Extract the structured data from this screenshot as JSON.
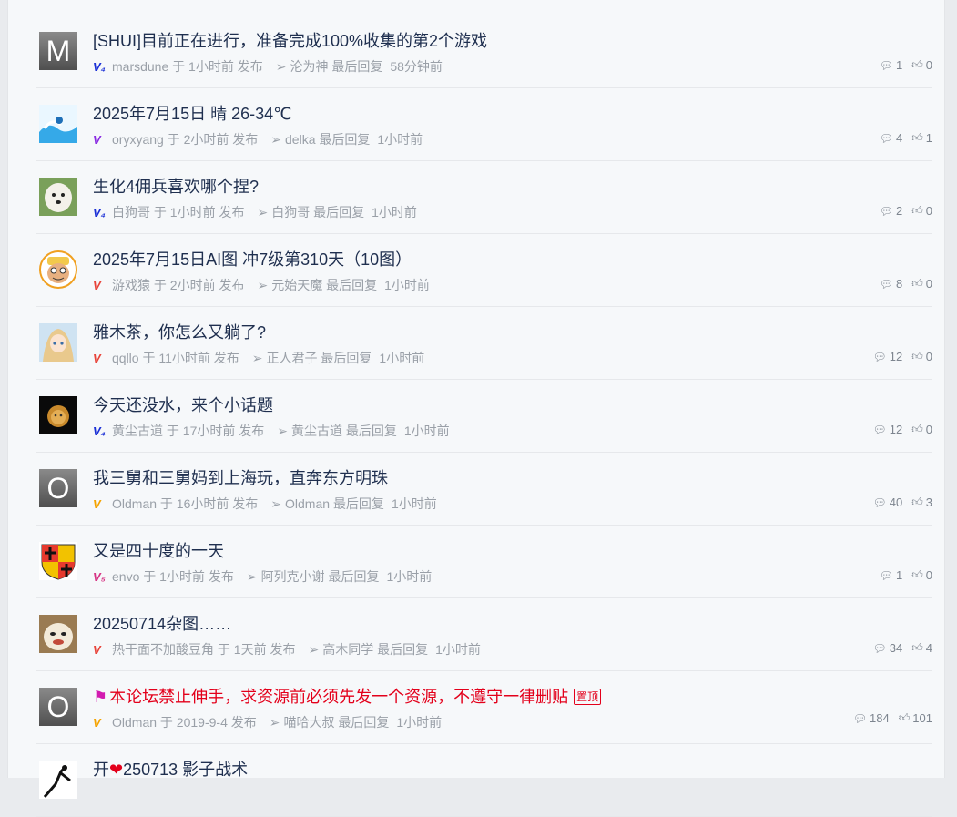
{
  "threads": [
    {
      "title": "[SHUI]目前正在进行，准备完成100%收集的第2个游戏",
      "badge": "V₄",
      "badge_color": "#1a2fd6",
      "author": "marsdune",
      "posted": "于 1小时前 发布",
      "last_replier": "沦为神",
      "last_label": "最后回复",
      "last_time": "58分钟前",
      "replies": "1",
      "likes": "0",
      "avatar_letter": "M",
      "avatar_type": "letter"
    },
    {
      "title": "2025年7月15日 晴 26-34℃",
      "badge": "V",
      "badge_color": "#8a2be2",
      "author": "oryxyang",
      "posted": "于 2小时前 发布",
      "last_replier": "delka",
      "last_label": "最后回复",
      "last_time": "1小时前",
      "replies": "4",
      "likes": "1",
      "avatar_type": "wave"
    },
    {
      "title": "生化4佣兵喜欢哪个捏?",
      "badge": "V₄",
      "badge_color": "#1a2fd6",
      "author": "白狗哥",
      "posted": "于 1小时前 发布",
      "last_replier": "白狗哥",
      "last_label": "最后回复",
      "last_time": "1小时前",
      "replies": "2",
      "likes": "0",
      "avatar_type": "dog"
    },
    {
      "title": "2025年7月15日AI图 冲7级第310天（10图）",
      "badge": "V",
      "badge_color": "#e8443a",
      "author": "游戏猿",
      "posted": "于 2小时前 发布",
      "last_replier": "元始天魔",
      "last_label": "最后回复",
      "last_time": "1小时前",
      "replies": "8",
      "likes": "0",
      "avatar_type": "monkey"
    },
    {
      "title": "雅木茶，你怎么又躺了?",
      "badge": "V",
      "badge_color": "#e8443a",
      "author": "qqllo",
      "posted": "于 11小时前 发布",
      "last_replier": "正人君子",
      "last_label": "最后回复",
      "last_time": "1小时前",
      "replies": "12",
      "likes": "0",
      "avatar_type": "anime"
    },
    {
      "title": "今天还没水，来个小话题",
      "badge": "V₄",
      "badge_color": "#1a2fd6",
      "author": "黄尘古道",
      "posted": "于 17小时前 发布",
      "last_replier": "黄尘古道",
      "last_label": "最后回复",
      "last_time": "1小时前",
      "replies": "12",
      "likes": "0",
      "avatar_type": "lion"
    },
    {
      "title": "我三舅和三舅妈到上海玩，直奔东方明珠",
      "badge": "V",
      "badge_color": "#f5a300",
      "author": "Oldman",
      "posted": "于 16小时前 发布",
      "last_replier": "Oldman",
      "last_label": "最后回复",
      "last_time": "1小时前",
      "replies": "40",
      "likes": "3",
      "avatar_letter": "O",
      "avatar_type": "letter"
    },
    {
      "title": "又是四十度的一天",
      "badge": "V₅",
      "badge_color": "#d63384",
      "author": "envo",
      "posted": "于 1小时前 发布",
      "last_replier": "阿列克小谢",
      "last_label": "最后回复",
      "last_time": "1小时前",
      "replies": "1",
      "likes": "0",
      "avatar_type": "shield"
    },
    {
      "title": "20250714杂图……",
      "badge": "V",
      "badge_color": "#e8443a",
      "author": "热干面不加酸豆角",
      "posted": "于 1天前 发布",
      "last_replier": "高木同学",
      "last_label": "最后回复",
      "last_time": "1小时前",
      "replies": "34",
      "likes": "4",
      "avatar_type": "cat"
    },
    {
      "title": "本论坛禁止伸手，求资源前必须先发一个资源，不遵守一律删贴",
      "badge": "V",
      "badge_color": "#f5a300",
      "author": "Oldman",
      "posted": "于 2019-9-4 发布",
      "last_replier": "喵哈大叔",
      "last_label": "最后回复",
      "last_time": "1小时前",
      "replies": "184",
      "likes": "101",
      "avatar_letter": "O",
      "avatar_type": "letter",
      "pinned": true,
      "pinned_label": "置顶",
      "red": true
    },
    {
      "title_prefix": "开",
      "title_suffix": "250713 影子战术",
      "badge": "",
      "author": "",
      "posted": "",
      "last_replier": "",
      "last_label": "",
      "last_time": "",
      "replies": "",
      "likes": "",
      "avatar_type": "silhouette",
      "partial": true
    }
  ]
}
